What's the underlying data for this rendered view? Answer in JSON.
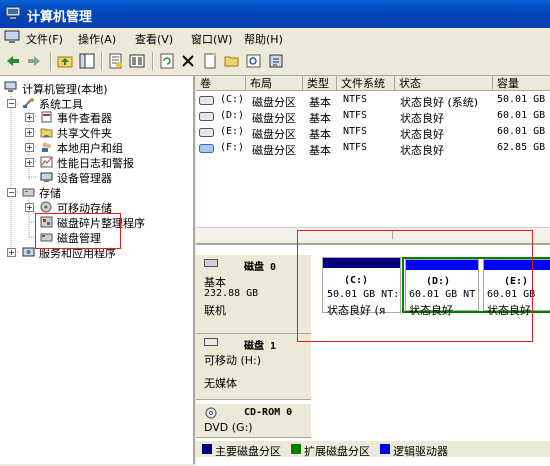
{
  "window": {
    "title": "计算机管理"
  },
  "menu": {
    "items": [
      "文件(F)",
      "操作(A)",
      "查看(V)",
      "窗口(W)",
      "帮助(H)"
    ]
  },
  "toolbar": {
    "icons": [
      "back-arrow-icon",
      "forward-arrow-icon",
      "up-folder-icon",
      "show-tree-icon",
      "properties-icon",
      "export-icon",
      "refresh-icon",
      "delete-icon",
      "new-icon",
      "open-folder-icon",
      "find-icon",
      "settings-icon"
    ]
  },
  "tree": {
    "root": "计算机管理(本地)",
    "system_tools": "系统工具",
    "event_viewer": "事件查看器",
    "shared_folders": "共享文件夹",
    "local_users": "本地用户和组",
    "perf_logs": "性能日志和警报",
    "device_manager": "设备管理器",
    "storage": "存储",
    "removable": "可移动存储",
    "defrag": "磁盘碎片整理程序",
    "disk_mgmt": "磁盘管理",
    "services": "服务和应用程序"
  },
  "volumes": {
    "headers": [
      "卷",
      "布局",
      "类型",
      "文件系统",
      "状态",
      "容量"
    ],
    "rows": [
      {
        "vol": "(C:)",
        "layout": "磁盘分区",
        "type": "基本",
        "fs": "NTFS",
        "status": "状态良好 (系统)",
        "capacity": "50.01 GB"
      },
      {
        "vol": "(D:)",
        "layout": "磁盘分区",
        "type": "基本",
        "fs": "NTFS",
        "status": "状态良好",
        "capacity": "60.01 GB"
      },
      {
        "vol": "(E:)",
        "layout": "磁盘分区",
        "type": "基本",
        "fs": "NTFS",
        "status": "状态良好",
        "capacity": "60.01 GB"
      },
      {
        "vol": "(F:)",
        "layout": "磁盘分区",
        "type": "基本",
        "fs": "NTFS",
        "status": "状态良好",
        "capacity": "62.85 GB"
      }
    ]
  },
  "disks": {
    "disk0": {
      "name": "磁盘 0",
      "type": "基本",
      "size": "232.88 GB",
      "state": "联机",
      "partitions": [
        {
          "label": "(C:)",
          "size": "50.01 GB NT:",
          "status": "状态良好 (я"
        },
        {
          "label": "(D:)",
          "size": "60.01 GB NT",
          "status": "状态良好"
        },
        {
          "label": "(E:)",
          "size": "60.01 GB",
          "status": "状态良好"
        }
      ]
    },
    "disk1": {
      "name": "磁盘 1",
      "type": "可移动 (H:)",
      "media": "无媒体"
    },
    "cdrom": {
      "name": "CD-ROM 0",
      "type": "DVD (G:)"
    }
  },
  "legend": {
    "primary": "主要磁盘分区",
    "extended": "扩展磁盘分区",
    "logical": "逻辑驱动器"
  },
  "colors": {
    "primary": "#000080",
    "extended": "#008000",
    "logical": "#0000ff",
    "highlight": "#e0201c",
    "titlebar": "#0a5fd8"
  }
}
